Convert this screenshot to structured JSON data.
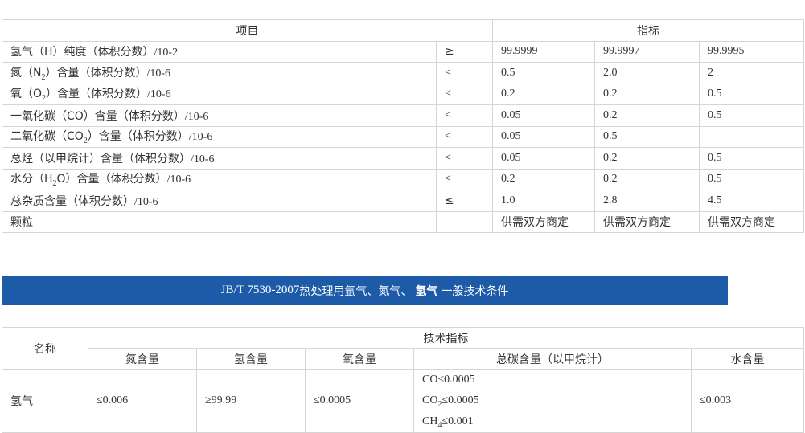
{
  "table1": {
    "header": {
      "item": "项目",
      "spec": "指标"
    },
    "rows": [
      {
        "label": [
          "氢气（H）纯度（体积分数）",
          "/10-2"
        ],
        "op": "≥",
        "v": [
          "99.9999",
          "99.9997",
          "99.9995"
        ]
      },
      {
        "label": [
          "氮（N",
          "2",
          "）含量（体积分数）",
          "/10-6"
        ],
        "op": "<",
        "v": [
          "0.5",
          "2.0",
          "2"
        ]
      },
      {
        "label": [
          "氧（O",
          "2",
          "）含量（体积分数）",
          "/10-6"
        ],
        "op": "<",
        "v": [
          "0.2",
          "0.2",
          "0.5"
        ]
      },
      {
        "label": [
          "一氧化碳（CO）含量（体积分数）",
          "/10-6"
        ],
        "op": "<",
        "v": [
          "0.05",
          "0.2",
          "0.5"
        ]
      },
      {
        "label": [
          "二氧化碳（CO",
          "2",
          "）含量（体积分数）",
          "/10-6"
        ],
        "op": "<",
        "v": [
          "0.05",
          "0.5",
          ""
        ]
      },
      {
        "label": [
          "总烃（以甲烷计）含量（体积分数）",
          "/10-6"
        ],
        "op": "<",
        "v": [
          "0.05",
          "0.2",
          "0.5"
        ]
      },
      {
        "label": [
          "水分（H",
          "2",
          "O）含量（体积分数）",
          "/10-6"
        ],
        "op": "<",
        "v": [
          "0.2",
          "0.2",
          "0.5"
        ]
      },
      {
        "label": [
          "总杂质含量（体积分数）",
          "/10-6"
        ],
        "op": "≤",
        "v": [
          "1.0",
          "2.8",
          "4.5"
        ]
      },
      {
        "label": [
          "颗粒",
          ""
        ],
        "op": "",
        "v": [
          "供需双方商定",
          "供需双方商定",
          "供需双方商定"
        ]
      }
    ]
  },
  "banner": {
    "prefix": "JB/T 7530-2007",
    "middle": "热处理用氩气、氮气、",
    "link": "氢气",
    "suffix": " 一般技术条件"
  },
  "table2": {
    "name_header": "名称",
    "group_header": "技术指标",
    "cols": [
      "氮含量",
      "氢含量",
      "氧含量",
      "总碳含量（以甲烷计）",
      "水含量"
    ],
    "row": {
      "name": "氢气",
      "n": "≤0.006",
      "h": "≥99.99",
      "o": "≤0.0005",
      "c": [
        "CO≤0.0005",
        "CO",
        "2",
        "≤0.0005",
        "CH",
        "4",
        "≤0.001"
      ],
      "w": "≤0.003"
    }
  }
}
